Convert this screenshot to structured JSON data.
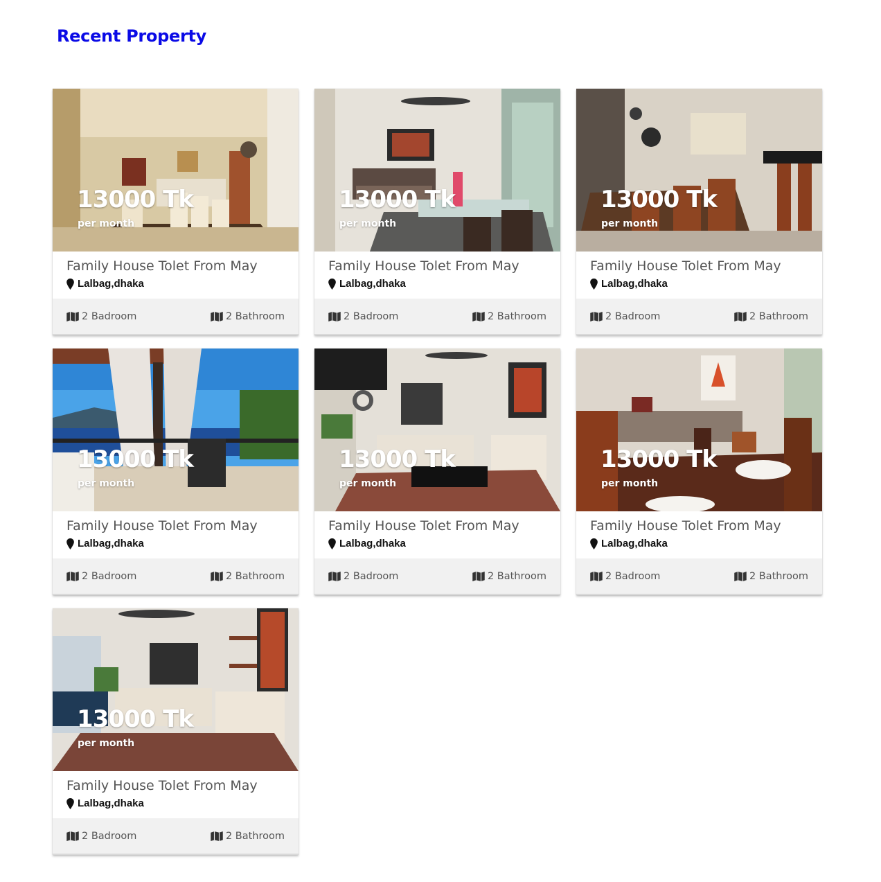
{
  "section": {
    "title": "Recent Property"
  },
  "properties": [
    {
      "price": "13000 Tk",
      "period": "per month",
      "title": "Family House Tolet From May",
      "location": "Lalbag,dhaka",
      "bedrooms": "2 Badroom",
      "bathrooms": "2 Bathroom",
      "photo": "dining-room"
    },
    {
      "price": "13000 Tk",
      "period": "per month",
      "title": "Family House Tolet From May",
      "location": "Lalbag,dhaka",
      "bedrooms": "2 Badroom",
      "bathrooms": "2 Bathroom",
      "photo": "living-dining"
    },
    {
      "price": "13000 Tk",
      "period": "per month",
      "title": "Family House Tolet From May",
      "location": "Lalbag,dhaka",
      "bedrooms": "2 Badroom",
      "bathrooms": "2 Bathroom",
      "photo": "kitchen-bar"
    },
    {
      "price": "13000 Tk",
      "period": "per month",
      "title": "Family House Tolet From May",
      "location": "Lalbag,dhaka",
      "bedrooms": "2 Badroom",
      "bathrooms": "2 Bathroom",
      "photo": "balcony-sea"
    },
    {
      "price": "13000 Tk",
      "period": "per month",
      "title": "Family House Tolet From May",
      "location": "Lalbag,dhaka",
      "bedrooms": "2 Badroom",
      "bathrooms": "2 Bathroom",
      "photo": "living-room"
    },
    {
      "price": "13000 Tk",
      "period": "per month",
      "title": "Family House Tolet From May",
      "location": "Lalbag,dhaka",
      "bedrooms": "2 Badroom",
      "bathrooms": "2 Bathroom",
      "photo": "dining-table"
    },
    {
      "price": "13000 Tk",
      "period": "per month",
      "title": "Family House Tolet From May",
      "location": "Lalbag,dhaka",
      "bedrooms": "2 Badroom",
      "bathrooms": "2 Bathroom",
      "photo": "living-room-2"
    }
  ],
  "colors": {
    "heading": "#0a0ae6",
    "stats_bg": "#f1f1f1",
    "title_text": "#555555"
  },
  "icons": {
    "location": "map-marker-icon",
    "rooms": "folded-map-icon"
  }
}
